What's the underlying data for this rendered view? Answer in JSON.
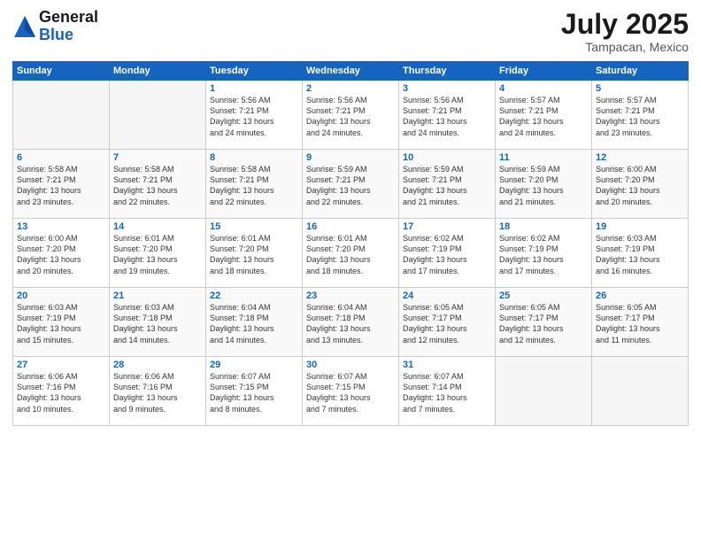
{
  "header": {
    "logo_general": "General",
    "logo_blue": "Blue",
    "month": "July 2025",
    "location": "Tampacan, Mexico"
  },
  "weekdays": [
    "Sunday",
    "Monday",
    "Tuesday",
    "Wednesday",
    "Thursday",
    "Friday",
    "Saturday"
  ],
  "weeks": [
    [
      {
        "day": "",
        "info": ""
      },
      {
        "day": "",
        "info": ""
      },
      {
        "day": "1",
        "info": "Sunrise: 5:56 AM\nSunset: 7:21 PM\nDaylight: 13 hours\nand 24 minutes."
      },
      {
        "day": "2",
        "info": "Sunrise: 5:56 AM\nSunset: 7:21 PM\nDaylight: 13 hours\nand 24 minutes."
      },
      {
        "day": "3",
        "info": "Sunrise: 5:56 AM\nSunset: 7:21 PM\nDaylight: 13 hours\nand 24 minutes."
      },
      {
        "day": "4",
        "info": "Sunrise: 5:57 AM\nSunset: 7:21 PM\nDaylight: 13 hours\nand 24 minutes."
      },
      {
        "day": "5",
        "info": "Sunrise: 5:57 AM\nSunset: 7:21 PM\nDaylight: 13 hours\nand 23 minutes."
      }
    ],
    [
      {
        "day": "6",
        "info": "Sunrise: 5:58 AM\nSunset: 7:21 PM\nDaylight: 13 hours\nand 23 minutes."
      },
      {
        "day": "7",
        "info": "Sunrise: 5:58 AM\nSunset: 7:21 PM\nDaylight: 13 hours\nand 22 minutes."
      },
      {
        "day": "8",
        "info": "Sunrise: 5:58 AM\nSunset: 7:21 PM\nDaylight: 13 hours\nand 22 minutes."
      },
      {
        "day": "9",
        "info": "Sunrise: 5:59 AM\nSunset: 7:21 PM\nDaylight: 13 hours\nand 22 minutes."
      },
      {
        "day": "10",
        "info": "Sunrise: 5:59 AM\nSunset: 7:21 PM\nDaylight: 13 hours\nand 21 minutes."
      },
      {
        "day": "11",
        "info": "Sunrise: 5:59 AM\nSunset: 7:20 PM\nDaylight: 13 hours\nand 21 minutes."
      },
      {
        "day": "12",
        "info": "Sunrise: 6:00 AM\nSunset: 7:20 PM\nDaylight: 13 hours\nand 20 minutes."
      }
    ],
    [
      {
        "day": "13",
        "info": "Sunrise: 6:00 AM\nSunset: 7:20 PM\nDaylight: 13 hours\nand 20 minutes."
      },
      {
        "day": "14",
        "info": "Sunrise: 6:01 AM\nSunset: 7:20 PM\nDaylight: 13 hours\nand 19 minutes."
      },
      {
        "day": "15",
        "info": "Sunrise: 6:01 AM\nSunset: 7:20 PM\nDaylight: 13 hours\nand 18 minutes."
      },
      {
        "day": "16",
        "info": "Sunrise: 6:01 AM\nSunset: 7:20 PM\nDaylight: 13 hours\nand 18 minutes."
      },
      {
        "day": "17",
        "info": "Sunrise: 6:02 AM\nSunset: 7:19 PM\nDaylight: 13 hours\nand 17 minutes."
      },
      {
        "day": "18",
        "info": "Sunrise: 6:02 AM\nSunset: 7:19 PM\nDaylight: 13 hours\nand 17 minutes."
      },
      {
        "day": "19",
        "info": "Sunrise: 6:03 AM\nSunset: 7:19 PM\nDaylight: 13 hours\nand 16 minutes."
      }
    ],
    [
      {
        "day": "20",
        "info": "Sunrise: 6:03 AM\nSunset: 7:19 PM\nDaylight: 13 hours\nand 15 minutes."
      },
      {
        "day": "21",
        "info": "Sunrise: 6:03 AM\nSunset: 7:18 PM\nDaylight: 13 hours\nand 14 minutes."
      },
      {
        "day": "22",
        "info": "Sunrise: 6:04 AM\nSunset: 7:18 PM\nDaylight: 13 hours\nand 14 minutes."
      },
      {
        "day": "23",
        "info": "Sunrise: 6:04 AM\nSunset: 7:18 PM\nDaylight: 13 hours\nand 13 minutes."
      },
      {
        "day": "24",
        "info": "Sunrise: 6:05 AM\nSunset: 7:17 PM\nDaylight: 13 hours\nand 12 minutes."
      },
      {
        "day": "25",
        "info": "Sunrise: 6:05 AM\nSunset: 7:17 PM\nDaylight: 13 hours\nand 12 minutes."
      },
      {
        "day": "26",
        "info": "Sunrise: 6:05 AM\nSunset: 7:17 PM\nDaylight: 13 hours\nand 11 minutes."
      }
    ],
    [
      {
        "day": "27",
        "info": "Sunrise: 6:06 AM\nSunset: 7:16 PM\nDaylight: 13 hours\nand 10 minutes."
      },
      {
        "day": "28",
        "info": "Sunrise: 6:06 AM\nSunset: 7:16 PM\nDaylight: 13 hours\nand 9 minutes."
      },
      {
        "day": "29",
        "info": "Sunrise: 6:07 AM\nSunset: 7:15 PM\nDaylight: 13 hours\nand 8 minutes."
      },
      {
        "day": "30",
        "info": "Sunrise: 6:07 AM\nSunset: 7:15 PM\nDaylight: 13 hours\nand 7 minutes."
      },
      {
        "day": "31",
        "info": "Sunrise: 6:07 AM\nSunset: 7:14 PM\nDaylight: 13 hours\nand 7 minutes."
      },
      {
        "day": "",
        "info": ""
      },
      {
        "day": "",
        "info": ""
      }
    ]
  ]
}
